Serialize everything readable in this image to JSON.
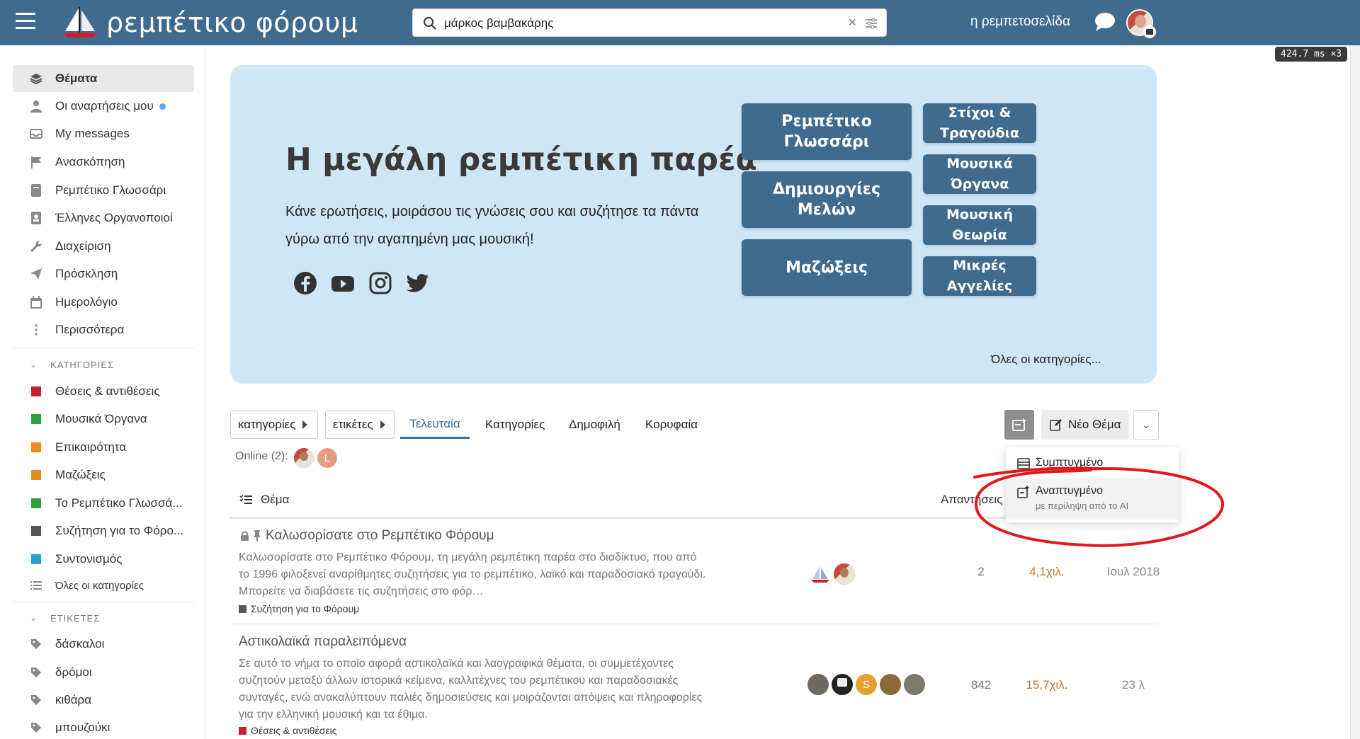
{
  "header": {
    "logo_text": "ρεμπέτικο φόρουμ",
    "search_value": "μάρκος βαμβακάρης",
    "home_link": "η ρεμπετοσελίδα"
  },
  "perf_badge": "424.7 ms ×3",
  "sidebar": {
    "nav": [
      {
        "label": "Θέματα",
        "icon": "layers-icon"
      },
      {
        "label": "Οι αναρτήσεις μου",
        "icon": "user-icon"
      },
      {
        "label": "My messages",
        "icon": "inbox-icon"
      },
      {
        "label": "Ανασκόπηση",
        "icon": "flag-icon"
      },
      {
        "label": "Ρεμπέτικο Γλωσσάρι",
        "icon": "book-icon"
      },
      {
        "label": "Έλληνες Οργανοποιοί",
        "icon": "address-book-icon"
      },
      {
        "label": "Διαχείριση",
        "icon": "wrench-icon"
      },
      {
        "label": "Πρόσκληση",
        "icon": "paper-plane-icon"
      },
      {
        "label": "Ημερολόγιο",
        "icon": "calendar-icon"
      },
      {
        "label": "Περισσότερα",
        "icon": "more-vertical-icon"
      }
    ],
    "categories_head": "ΚΑΤΗΓΟΡΙΕΣ",
    "categories": [
      {
        "label": "Θέσεις & αντιθέσεις",
        "color": "#c8202f"
      },
      {
        "label": "Μουσικά Όργανα",
        "color": "#2aa33d"
      },
      {
        "label": "Επικαιρότητα",
        "color": "#f08a1c"
      },
      {
        "label": "Μαζώξεις",
        "color": "#e08e1e"
      },
      {
        "label": "Το Ρεμπέτικο Γλωσσά...",
        "color": "#2aa33d"
      },
      {
        "label": "Συζήτηση για το Φόρο...",
        "color": "#555555"
      },
      {
        "label": "Συντονισμός",
        "color": "#2a9fd6"
      }
    ],
    "all_categories": "Όλες οι κατηγορίες",
    "tags_head": "ΕΤΙΚΕΤΕΣ",
    "tags": [
      "δάσκαλοι",
      "δρόμοι",
      "κιθάρα",
      "μπουζούκι"
    ]
  },
  "banner": {
    "title": "Η μεγάλη ρεμπέτικη παρέα",
    "text": "Κάνε ερωτήσεις, μοιράσου τις γνώσεις σου και συζήτησε τα πάντα γύρω από την αγαπημένη μας μουσική!",
    "buttons": {
      "glossary": "Ρεμπέτικο Γλωσσάρι",
      "creations": "Δημιουργίες Μελών",
      "gatherings": "Μαζώξεις",
      "lyrics": "Στίχοι & Τραγούδια",
      "instruments": "Μουσικά Όργανα",
      "theory": "Μουσική Θεωρία",
      "classifieds": "Μικρές Αγγελίες"
    },
    "all_categories": "Όλες οι κατηγορίες..."
  },
  "toolbar": {
    "categories_filter": "κατηγορίες",
    "tags_filter": "ετικέτες",
    "tabs": [
      "Τελευταία",
      "Κατηγορίες",
      "Δημοφιλή",
      "Κορυφαία"
    ],
    "new_topic": "Νέο Θέμα"
  },
  "online": {
    "label": "Online (2):",
    "second_initial": "L"
  },
  "dropdown": {
    "item1": "Συμπτυγμένο",
    "item2": "Αναπτυγμένο",
    "item2_sub": "με περίληψη από το AI"
  },
  "list": {
    "topic_header": "Θέμα",
    "replies_header": "Απαντήσεις"
  },
  "topics": [
    {
      "title": "Καλωσορίσατε στο Ρεμπέτικο Φόρουμ",
      "excerpt": "Καλωσορίσατε στο Ρεμπέτικο Φόρουμ, τη μεγάλη ρεμπέτικη παρέα στο διαδίκτυο, που από το 1996 φιλοξενεί αναρίθμητες συζητήσεις για το ρεμπέτικο, λαϊκό και παραδοσιακό τραγούδι. Μπορείτε να διαβάσετε τις συζητήσεις στο φόρ…",
      "category": "Συζήτηση για το Φόρουμ",
      "category_color": "#555555",
      "replies": "2",
      "views": "4,1χιλ.",
      "activity": "Ιουλ 2018"
    },
    {
      "title": "Αστικολαϊκά παραλειπόμενα",
      "excerpt": "Σε αυτό το νήμα το οποίο αφορά αστικολαϊκά και λαογραφικά θέματα, οι συμμετέχοντες συζητούν μεταξύ άλλων ιστορικά κείμενα, καλλιτέχνες του ρεμπέτικου και παραδοσιακές συνταγές, ενώ ανακαλύπτουν παλιές δημοσιεύσεις και μοιράζονται απόψεις και πληροφορίες για την ελληνική μουσική και τα έθιμα.",
      "category": "Θέσεις & αντιθέσεις",
      "category_color": "#c8202f",
      "replies": "842",
      "views": "15,7χιλ.",
      "activity": "23 λ",
      "poster_initial": "S"
    }
  ]
}
